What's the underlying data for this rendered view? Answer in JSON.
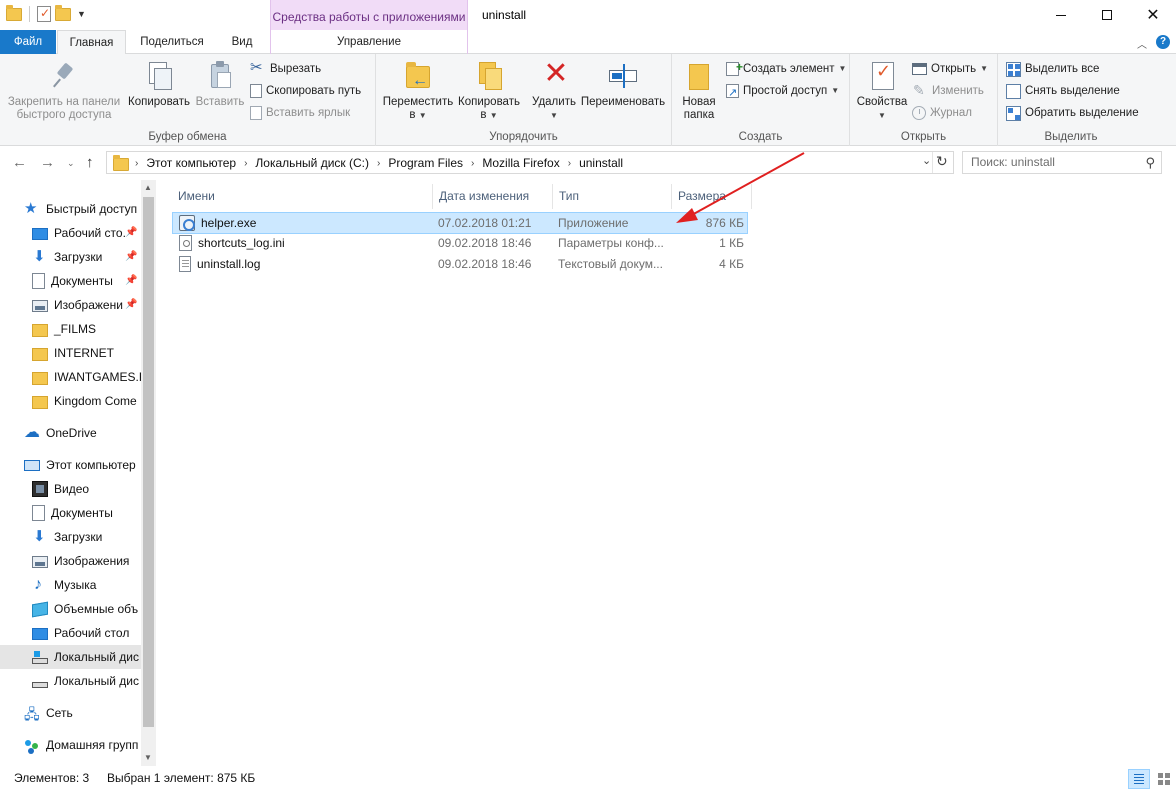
{
  "window": {
    "title": "uninstall",
    "contextual_tab_header": "Средства работы с приложениями"
  },
  "tabs": {
    "file": "Файл",
    "home": "Главная",
    "share": "Поделиться",
    "view": "Вид",
    "manage": "Управление"
  },
  "ribbon": {
    "clipboard": {
      "label": "Буфер обмена",
      "pin": "Закрепить на панели быстрого доступа",
      "copy": "Копировать",
      "paste": "Вставить",
      "cut": "Вырезать",
      "copy_path": "Скопировать путь",
      "paste_shortcut": "Вставить ярлык"
    },
    "organize": {
      "label": "Упорядочить",
      "move_to": "Переместить в",
      "copy_to": "Копировать в",
      "delete": "Удалить",
      "rename": "Переименовать"
    },
    "new": {
      "label": "Создать",
      "new_folder": "Новая папка",
      "new_item": "Создать элемент",
      "easy_access": "Простой доступ"
    },
    "open": {
      "label": "Открыть",
      "properties": "Свойства",
      "open": "Открыть",
      "edit": "Изменить",
      "history": "Журнал"
    },
    "select": {
      "label": "Выделить",
      "select_all": "Выделить все",
      "select_none": "Снять выделение",
      "invert": "Обратить выделение"
    }
  },
  "address": {
    "breadcrumbs": [
      "Этот компьютер",
      "Локальный диск (C:)",
      "Program Files",
      "Mozilla Firefox",
      "uninstall"
    ],
    "search_placeholder": "Поиск: uninstall"
  },
  "nav_pane": {
    "quick_access": "Быстрый доступ",
    "items": [
      {
        "label": "Рабочий сто.",
        "icon": "desktop-icon",
        "pinned": true
      },
      {
        "label": "Загрузки",
        "icon": "downloads-icon",
        "pinned": true
      },
      {
        "label": "Документы",
        "icon": "documents-icon",
        "pinned": true
      },
      {
        "label": "Изображени",
        "icon": "pictures-icon",
        "pinned": true
      },
      {
        "label": "_FILMS",
        "icon": "folder-icon"
      },
      {
        "label": "INTERNET",
        "icon": "folder-icon"
      },
      {
        "label": "IWANTGAMES.R",
        "icon": "folder-icon"
      },
      {
        "label": "Kingdom Come",
        "icon": "folder-icon"
      }
    ],
    "onedrive": "OneDrive",
    "this_pc": "Этот компьютер",
    "pc_items": [
      {
        "label": "Видео",
        "icon": "videos-icon"
      },
      {
        "label": "Документы",
        "icon": "documents-icon"
      },
      {
        "label": "Загрузки",
        "icon": "downloads-icon"
      },
      {
        "label": "Изображения",
        "icon": "pictures-icon"
      },
      {
        "label": "Музыка",
        "icon": "music-icon"
      },
      {
        "label": "Объемные объ",
        "icon": "3d-objects-icon"
      },
      {
        "label": "Рабочий стол",
        "icon": "desktop-icon"
      },
      {
        "label": "Локальный дис",
        "icon": "system-drive-icon",
        "selected": true
      },
      {
        "label": "Локальный дис",
        "icon": "drive-icon"
      }
    ],
    "network": "Сеть",
    "homegroup": "Домашняя групп"
  },
  "file_list": {
    "columns": {
      "name": "Имени",
      "date": "Дата изменения",
      "type": "Тип",
      "size": "Размера"
    },
    "rows": [
      {
        "name": "helper.exe",
        "date": "07.02.2018 01:21",
        "type": "Приложение",
        "size": "876 КБ",
        "icon": "application-icon",
        "selected": true
      },
      {
        "name": "shortcuts_log.ini",
        "date": "09.02.2018 18:46",
        "type": "Параметры конф...",
        "size": "1 КБ",
        "icon": "settings-file-icon"
      },
      {
        "name": "uninstall.log",
        "date": "09.02.2018 18:46",
        "type": "Текстовый докум...",
        "size": "4 КБ",
        "icon": "text-file-icon"
      }
    ]
  },
  "status": {
    "items": "Элементов: 3",
    "selection": "Выбран 1 элемент: 875 КБ"
  },
  "colors": {
    "file_tab": "#1979ca",
    "contextual_tab": "#f1dcf7",
    "selection": "#cce8ff",
    "annotation_arrow": "#e02020"
  }
}
